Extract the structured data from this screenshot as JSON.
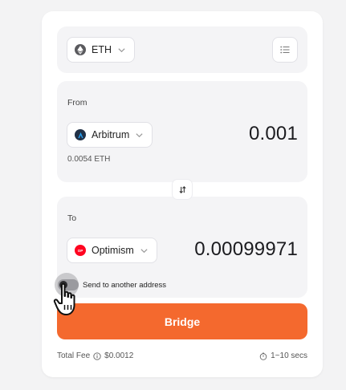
{
  "token": {
    "symbol": "ETH",
    "icon": "ethereum-icon"
  },
  "from": {
    "label": "From",
    "chain": "Arbitrum",
    "chain_color": "#213147",
    "amount": "0.001",
    "balance": "0.0054 ETH"
  },
  "to": {
    "label": "To",
    "chain": "Optimism",
    "chain_color": "#ff0420",
    "chain_badge": "OP",
    "amount": "0.00099971"
  },
  "send_to_other": {
    "label": "Send to another address",
    "enabled": false
  },
  "bridge": {
    "label": "Bridge",
    "color": "#f4692e"
  },
  "footer": {
    "fee_label": "Total Fee",
    "fee_value": "$0.0012",
    "time": "1~10 secs"
  }
}
